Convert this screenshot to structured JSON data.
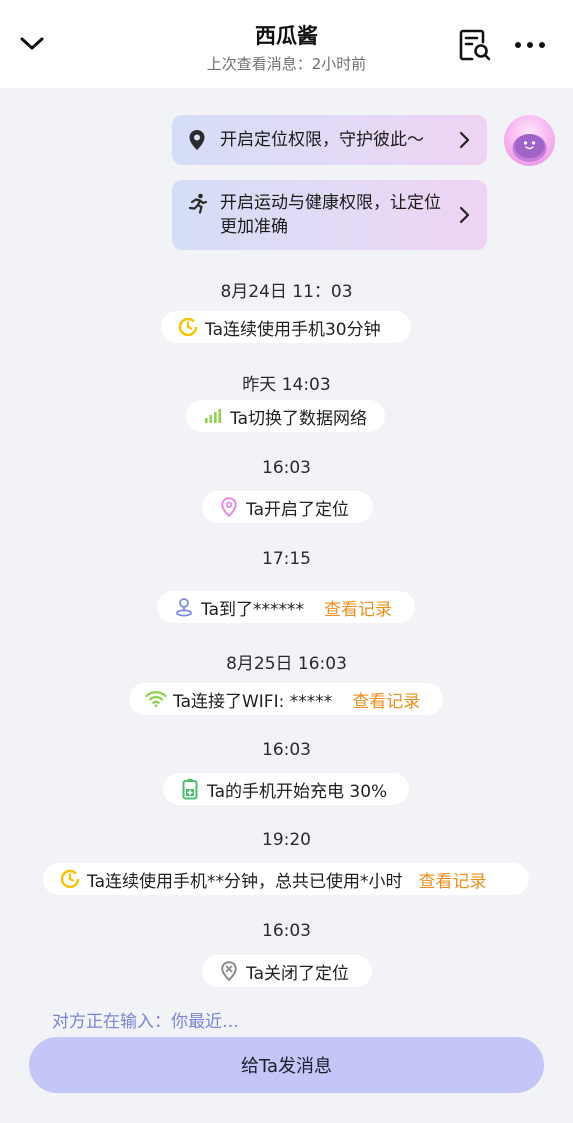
{
  "header": {
    "title": "西瓜酱",
    "subtitle": "上次查看消息：2小时前"
  },
  "permissions": [
    {
      "text": "开启定位权限，守护彼此～",
      "icon": "location-pin-icon"
    },
    {
      "text": "开启运动与健康权限，让定位更加准确",
      "icon": "running-icon"
    }
  ],
  "events": [
    {
      "time": "8月24日  11：03",
      "text": "Ta连续使用手机30分钟",
      "icon": "clock-icon"
    },
    {
      "time": "昨天  14:03",
      "text": "Ta切换了数据网络",
      "icon": "signal-bars-icon"
    },
    {
      "time": "16:03",
      "text": "Ta开启了定位",
      "icon": "location-pin-icon"
    },
    {
      "time": "17:15",
      "text": "Ta到了******",
      "link": "查看记录",
      "icon": "arrived-pin-icon"
    },
    {
      "time": "8月25日  16:03",
      "text": "Ta连接了WIFI: *****",
      "link": "查看记录",
      "icon": "wifi-icon"
    },
    {
      "time": "16:03",
      "text": "Ta的手机开始充电 30%",
      "icon": "battery-charging-icon"
    },
    {
      "time": "19:20",
      "text": "Ta连续使用手机**分钟，总共已使用*小时",
      "link": "查看记录",
      "icon": "clock-icon"
    },
    {
      "time": "16:03",
      "text": "Ta关闭了定位",
      "icon": "location-off-icon"
    }
  ],
  "typing": "对方正在输入：你最近…",
  "send_button": "给Ta发消息",
  "colors": {
    "background": "#f2f3f6",
    "link": "#ec8f1c",
    "typing": "#7b86d8",
    "send_button": "#c3c6f6",
    "clock_icon": "#f5c400",
    "signal_icon": "#8fd14f",
    "pin_icon": "#e88ae0",
    "arrived_icon": "#7e8be0",
    "wifi_icon": "#8fd14f",
    "battery_icon": "#4cbf6b",
    "location_off_icon": "#8a8a8f"
  }
}
